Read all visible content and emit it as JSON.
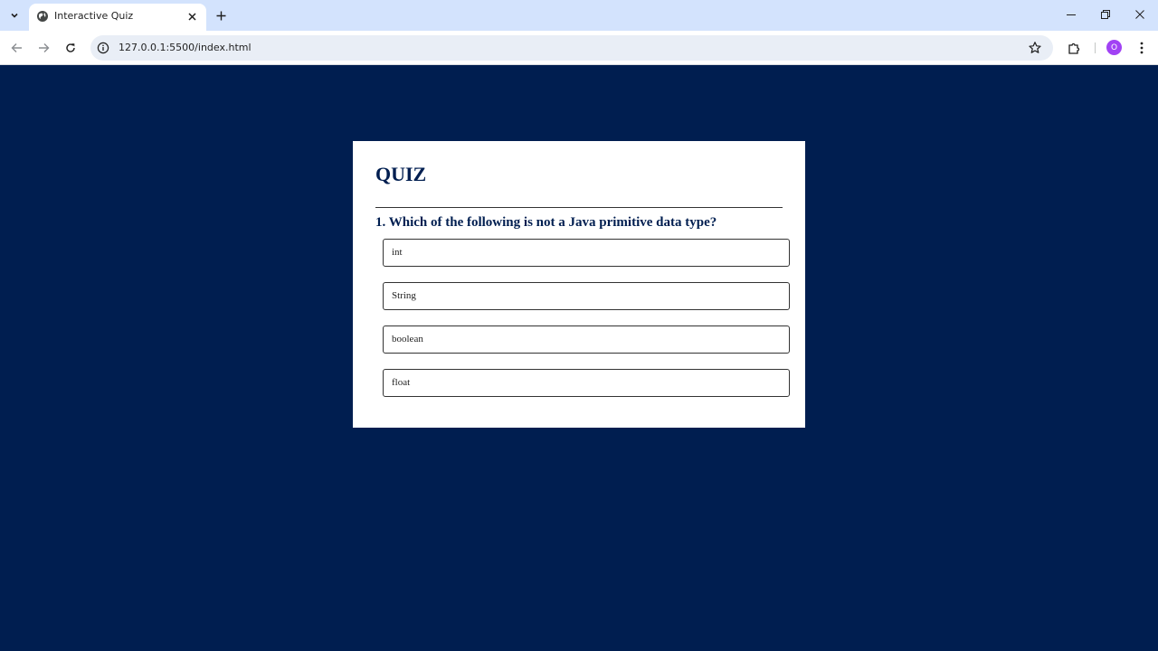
{
  "browser": {
    "tab_title": "Interactive Quiz",
    "url": "127.0.0.1:5500/index.html",
    "profile_initial": "O"
  },
  "quiz": {
    "title": "QUIZ",
    "question": "1. Which of the following is not a Java primitive data type?",
    "options": [
      "int",
      "String",
      "boolean",
      "float"
    ]
  },
  "colors": {
    "page_background": "#001e50",
    "card_background": "#ffffff",
    "heading_text": "#001e50",
    "tabstrip": "#d3e3fd",
    "profile_avatar": "#a142f4"
  },
  "icons": {
    "tab_search": "chevron-down-icon",
    "favicon": "globe-icon",
    "tab_close": "close-icon",
    "new_tab": "plus-icon",
    "back": "arrow-left-icon",
    "forward": "arrow-right-icon",
    "reload": "reload-icon",
    "site_info": "info-icon",
    "bookmark": "star-icon",
    "extensions": "puzzle-icon",
    "menu": "kebab-menu-icon"
  }
}
